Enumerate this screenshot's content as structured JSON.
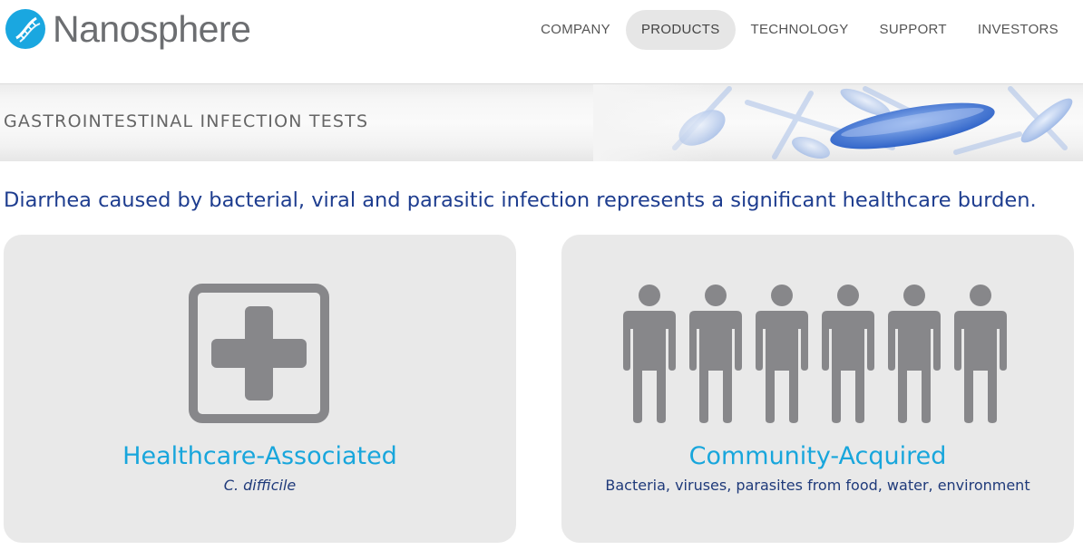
{
  "brand": {
    "name": "Nanosphere",
    "logo_color": "#1aa7e0",
    "text_color": "#6c6e71"
  },
  "nav": {
    "items": [
      {
        "label": "COMPANY",
        "active": false
      },
      {
        "label": "PRODUCTS",
        "active": true
      },
      {
        "label": "TECHNOLOGY",
        "active": false
      },
      {
        "label": "SUPPORT",
        "active": false
      },
      {
        "label": "INVESTORS",
        "active": false
      }
    ]
  },
  "banner": {
    "title": "GASTROINTESTINAL INFECTION TESTS"
  },
  "intro": {
    "text": "Diarrhea caused by bacterial, viral and parasitic infection represents a significant healthcare burden."
  },
  "cards": [
    {
      "title": "Healthcare-Associated",
      "subtitle": "C. difficile",
      "icon": "medical-cross-icon"
    },
    {
      "title": "Community-Acquired",
      "subtitle": "Bacteria, viruses, parasites from food, water, environment",
      "icon": "people-icon",
      "person_count": 6
    }
  ],
  "colors": {
    "accent_blue": "#18a6dc",
    "navy": "#1e3d8f",
    "icon_gray": "#87878a",
    "card_bg": "#e9e9e9"
  }
}
